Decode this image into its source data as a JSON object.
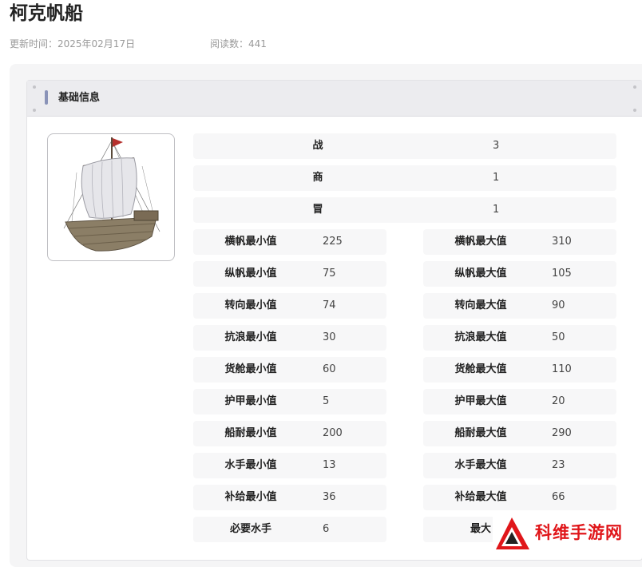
{
  "page": {
    "title": "柯克帆船",
    "update_time": "更新时间：2025年02月17日",
    "read_count": "阅读数：441"
  },
  "section": {
    "title": "基础信息"
  },
  "full_rows": [
    {
      "label": "战",
      "value": "3"
    },
    {
      "label": "商",
      "value": "1"
    },
    {
      "label": "冒",
      "value": "1"
    }
  ],
  "stat_rows": [
    {
      "min_label": "横帆最小值",
      "min_value": "225",
      "max_label": "横帆最大值",
      "max_value": "310"
    },
    {
      "min_label": "纵帆最小值",
      "min_value": "75",
      "max_label": "纵帆最大值",
      "max_value": "105"
    },
    {
      "min_label": "转向最小值",
      "min_value": "74",
      "max_label": "转向最大值",
      "max_value": "90"
    },
    {
      "min_label": "抗浪最小值",
      "min_value": "30",
      "max_label": "抗浪最大值",
      "max_value": "50"
    },
    {
      "min_label": "货舱最小值",
      "min_value": "60",
      "max_label": "货舱最大值",
      "max_value": "110"
    },
    {
      "min_label": "护甲最小值",
      "min_value": "5",
      "max_label": "护甲最大值",
      "max_value": "20"
    },
    {
      "min_label": "船耐最小值",
      "min_value": "200",
      "max_label": "船耐最大值",
      "max_value": "290"
    },
    {
      "min_label": "水手最小值",
      "min_value": "13",
      "max_label": "水手最大值",
      "max_value": "23"
    },
    {
      "min_label": "补给最小值",
      "min_value": "36",
      "max_label": "补给最大值",
      "max_value": "66"
    },
    {
      "min_label": "必要水手",
      "min_value": "6",
      "max_label": "最大",
      "max_value": ""
    }
  ],
  "watermark": {
    "text": "科维手游网"
  },
  "colors": {
    "accent_bar": "#8a93b8",
    "watermark_red": "#e0161a"
  }
}
